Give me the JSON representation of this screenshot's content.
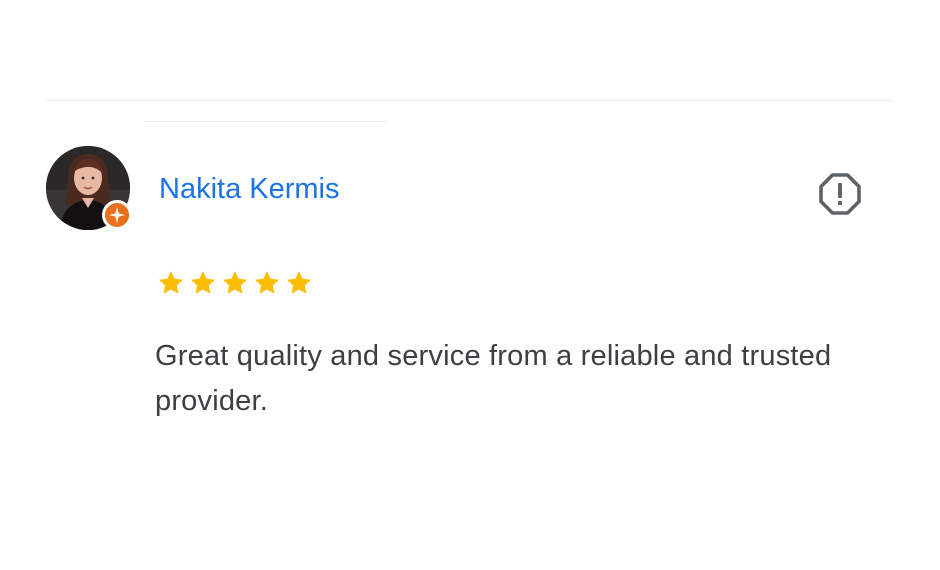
{
  "review": {
    "reviewer_name": "Nakita Kermis",
    "rating": 5,
    "rating_max": 5,
    "text": "Great quality and service from a reliable and trusted provider.",
    "badge": "local-guide-badge",
    "flag_icon": "report-icon"
  },
  "colors": {
    "name": "#1a73e8",
    "star": "#fbbc04",
    "badge": "#e8711c",
    "text": "#3c4043",
    "flag": "#5f6368"
  }
}
